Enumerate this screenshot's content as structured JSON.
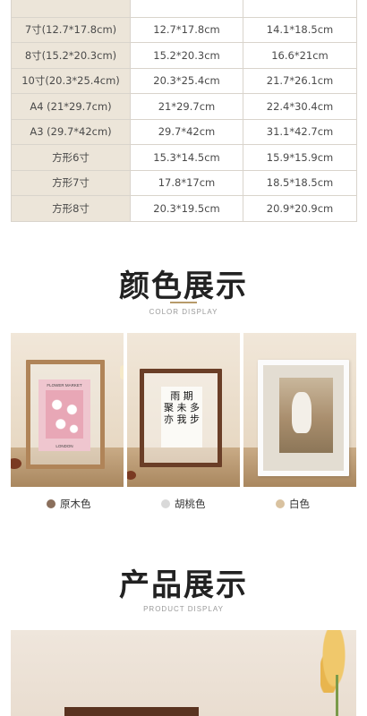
{
  "size_table": {
    "rows": [
      {
        "label": "",
        "photo": "",
        "frame": ""
      },
      {
        "label": "7寸(12.7*17.8cm)",
        "photo": "12.7*17.8cm",
        "frame": "14.1*18.5cm"
      },
      {
        "label": "8寸(15.2*20.3cm)",
        "photo": "15.2*20.3cm",
        "frame": "16.6*21cm"
      },
      {
        "label": "10寸(20.3*25.4cm)",
        "photo": "20.3*25.4cm",
        "frame": "21.7*26.1cm"
      },
      {
        "label": "A4 (21*29.7cm)",
        "photo": "21*29.7cm",
        "frame": "22.4*30.4cm"
      },
      {
        "label": "A3 (29.7*42cm)",
        "photo": "29.7*42cm",
        "frame": "31.1*42.7cm"
      },
      {
        "label": "方形6寸",
        "photo": "15.3*14.5cm",
        "frame": "15.9*15.9cm"
      },
      {
        "label": "方形7寸",
        "photo": "17.8*17cm",
        "frame": "18.5*18.5cm"
      },
      {
        "label": "方形8寸",
        "photo": "20.3*19.5cm",
        "frame": "20.9*20.9cm"
      }
    ]
  },
  "color_section": {
    "title": "颜色展示",
    "subtitle": "COLOR DISPLAY",
    "photos": [
      {
        "poster_top": "FLOWER MARKET",
        "poster_bottom": "LONDON"
      },
      {
        "calligraphy": "雨 期\n聚 未 多\n亦 我 步"
      },
      {}
    ],
    "legend": [
      {
        "label": "原木色",
        "color": "#8a6f5c"
      },
      {
        "label": "胡桃色",
        "color": "#d9d9d9"
      },
      {
        "label": "白色",
        "color": "#d9c2a0"
      }
    ]
  },
  "product_section": {
    "title": "产品展示",
    "subtitle": "PRODUCT DISPLAY"
  }
}
